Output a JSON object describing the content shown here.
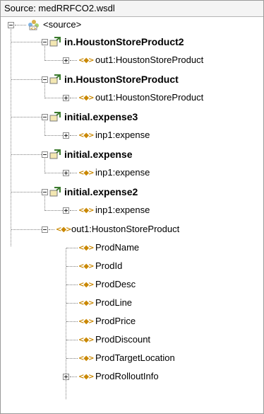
{
  "header": {
    "title": "Source: medRRFCO2.wsdl"
  },
  "tree": {
    "root": "<source>",
    "groups": [
      {
        "name": "in.HoustonStoreProduct2",
        "child": "out1:HoustonStoreProduct"
      },
      {
        "name": "in.HoustonStoreProduct",
        "child": "out1:HoustonStoreProduct"
      },
      {
        "name": "initial.expense3",
        "child": "inp1:expense"
      },
      {
        "name": "initial.expense",
        "child": "inp1:expense"
      },
      {
        "name": "initial.expense2",
        "child": "inp1:expense"
      }
    ],
    "element": {
      "name": "out1:HoustonStoreProduct",
      "fields": [
        "ProdName",
        "ProdId",
        "ProdDesc",
        "ProdLine",
        "ProdPrice",
        "ProdDiscount",
        "ProdTargetLocation",
        "ProdRolloutInfo"
      ]
    }
  },
  "icons": {
    "collapse": "minus-box-icon",
    "expand": "plus-box-icon",
    "root": "source-root-icon",
    "message": "message-link-icon",
    "element": "element-tag-icon"
  }
}
